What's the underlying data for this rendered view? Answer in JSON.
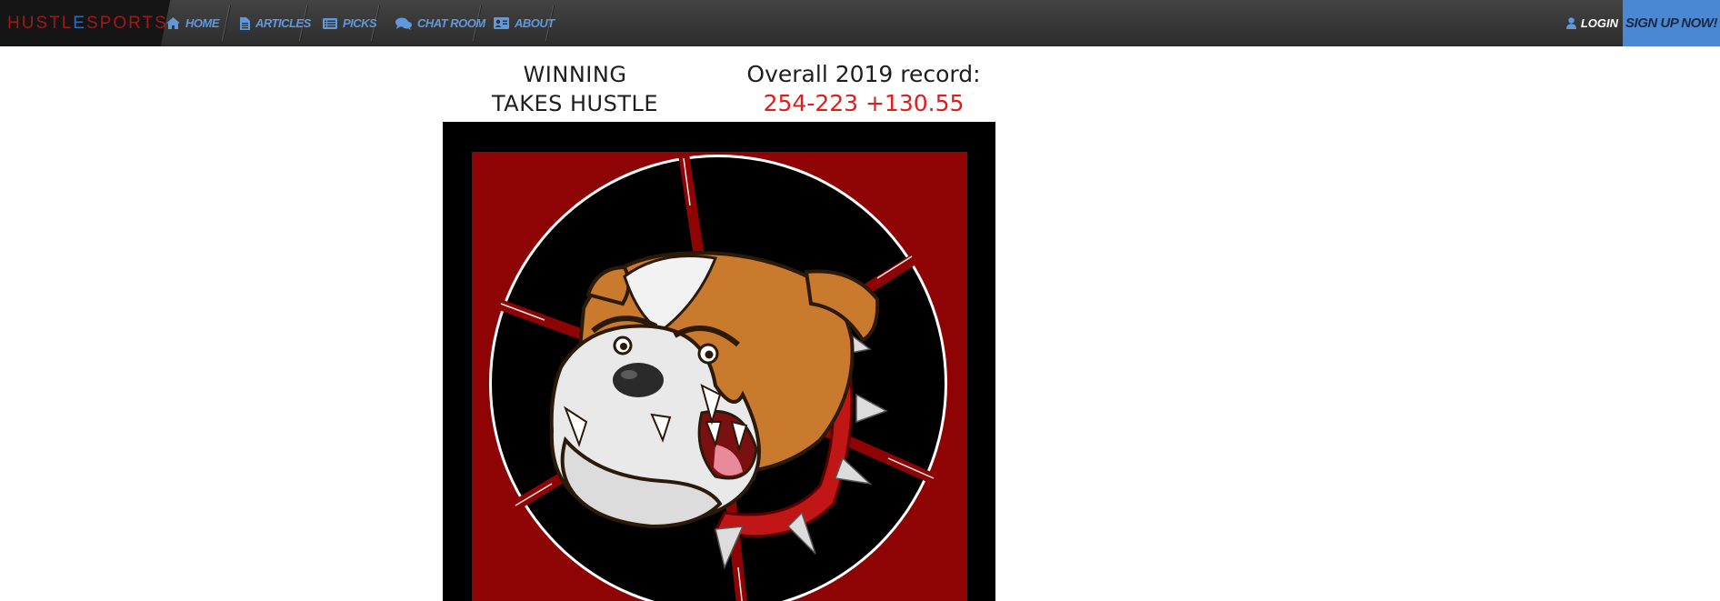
{
  "brand": {
    "part1": "HUSTL",
    "part2": "E",
    "part3": "SPORTS"
  },
  "nav": {
    "items": [
      {
        "label": "Home",
        "icon": "home-icon"
      },
      {
        "label": "Articles",
        "icon": "file-icon"
      },
      {
        "label": "Picks",
        "icon": "list-icon"
      },
      {
        "label": "Chat Room",
        "icon": "comments-icon"
      },
      {
        "label": "About",
        "icon": "id-card-icon"
      }
    ],
    "login_label": "Login",
    "signup_label": "Sign Up Now!"
  },
  "hero": {
    "tagline_line1": "WINNING",
    "tagline_line2": "TAKES HUSTLE",
    "record_label": "Overall 2019 record:",
    "record_value": "254-223 +130.55"
  },
  "colors": {
    "nav_link": "#5f98db",
    "signup_bg": "#4a88d4",
    "record_value": "#e21b1b",
    "logo_red": "#8e0404"
  },
  "logo": {
    "icon": "bulldog-mascot-logo"
  }
}
